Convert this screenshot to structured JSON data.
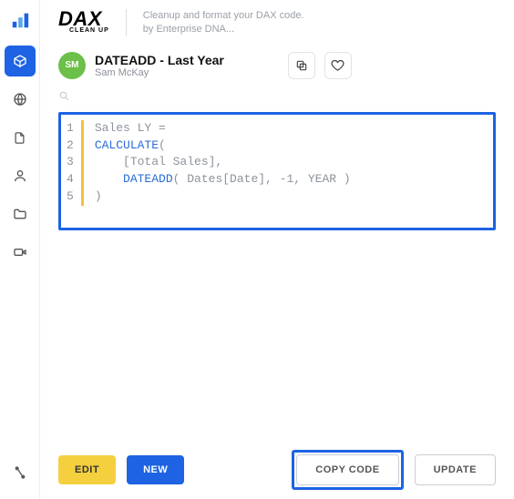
{
  "brand": {
    "name": "DAX",
    "sub": "CLEAN UP"
  },
  "tagline": {
    "line1": "Cleanup and format your DAX code.",
    "line2": "by Enterprise DNA..."
  },
  "doc": {
    "title": "DATEADD - Last Year",
    "author": "Sam McKay",
    "avatar": "SM"
  },
  "code": {
    "lines": [
      "1",
      "2",
      "3",
      "4",
      "5"
    ],
    "l1_a": "Sales LY =",
    "l2_kw": "CALCULATE",
    "l2_b": "(",
    "l3_a": "    [Total Sales],",
    "l4_kw": "    DATEADD",
    "l4_b": "( Dates[Date], -1, YEAR )",
    "l5_a": ")"
  },
  "buttons": {
    "edit": "EDIT",
    "new": "NEW",
    "copy": "COPY CODE",
    "update": "UPDATE"
  }
}
